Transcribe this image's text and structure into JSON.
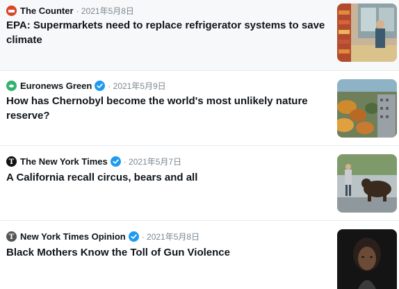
{
  "feed": {
    "items": [
      {
        "source": "The Counter",
        "date": "· 2021年5月8日",
        "verified": false,
        "headline": "EPA: Supermarkets need to replace refrigerator systems to save climate",
        "icon": "the-counter-logo-icon",
        "icon_color": "#d9472b",
        "thumbnail": "supermarket-aisle-image"
      },
      {
        "source": "Euronews Green",
        "date": "· 2021年5月9日",
        "verified": true,
        "headline": "How has Chernobyl become the world's most unlikely nature reserve?",
        "icon": "euronews-green-logo-icon",
        "icon_color": "#2fb36b",
        "thumbnail": "chernobyl-forest-image"
      },
      {
        "source": "The New York Times",
        "date": "· 2021年5月7日",
        "verified": true,
        "headline": "A California recall circus, bears and all",
        "icon": "nyt-logo-icon",
        "icon_color": "#111111",
        "thumbnail": "bear-on-street-image"
      },
      {
        "source": "New York Times Opinion",
        "date": "· 2021年5月8日",
        "verified": true,
        "headline": "Black Mothers Know the Toll of Gun Violence",
        "icon": "nyt-opinion-logo-icon",
        "icon_color": "#555555",
        "thumbnail": "portrait-woman-image"
      }
    ]
  },
  "colors": {
    "verified_badge": "#1d9bf0",
    "date_text": "#7a8791",
    "card_bg_shaded": "#f7f8f9"
  }
}
